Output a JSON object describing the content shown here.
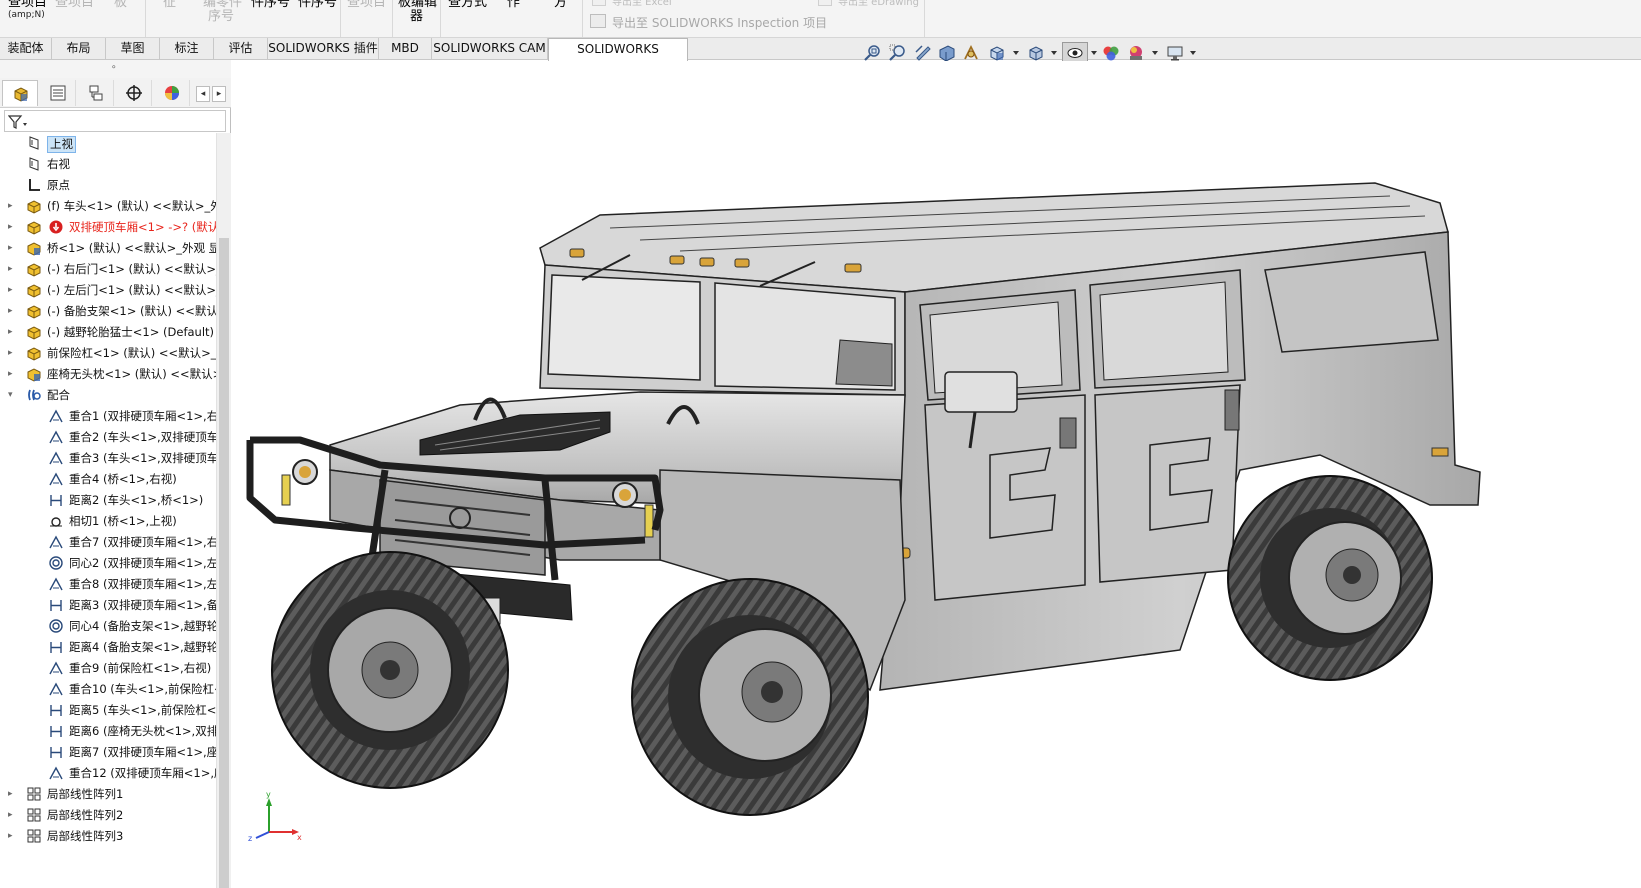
{
  "ribbon": {
    "buttons": [
      {
        "label": "查项目",
        "dim": false
      },
      {
        "label": "查项目",
        "dim": true
      },
      {
        "label": "板",
        "dim": true
      },
      {
        "label": "征",
        "dim": true
      },
      {
        "label": "编零件",
        "dim": true
      },
      {
        "label": "件序号",
        "dim": false
      },
      {
        "label": "件序号",
        "dim": false
      },
      {
        "label": "查项目",
        "dim": true
      },
      {
        "label": "板编辑",
        "dim": false
      },
      {
        "label": "查方式",
        "dim": false
      },
      {
        "label": "作",
        "dim": false
      },
      {
        "label": "方",
        "dim": false
      }
    ],
    "sub_label_1": "序号",
    "sub_label_2": "器",
    "shortcut": "(amp;N)",
    "export_top": "导出至 Excel",
    "export_label": "导出至 SOLIDWORKS Inspection 项目",
    "export_right": "导出至 eDrawing"
  },
  "command_tabs": [
    "装配体",
    "布局",
    "草图",
    "标注",
    "评估",
    "SOLIDWORKS 插件",
    "MBD",
    "SOLIDWORKS CAM",
    "SOLIDWORKS Inspection"
  ],
  "active_tab": "SOLIDWORKS Inspection",
  "hud_icons": [
    "zoom-to-fit-icon",
    "zoom-to-area-icon",
    "previous-view-icon",
    "section-view-icon",
    "dynamic-annotation-icon",
    "view-orientation-icon",
    "display-style-icon",
    "hide-show-items-icon",
    "edit-appearance-icon",
    "apply-scene-icon",
    "view-settings-icon"
  ],
  "feature_tree": {
    "tabs": [
      "featuremanager-tab",
      "propertymanager-tab",
      "configurationmanager-tab",
      "dimxpert-tab",
      "display-manager-tab"
    ],
    "items": [
      {
        "label": "上视",
        "icon": "plane-icon",
        "indent": 1,
        "expand": "",
        "selected": true
      },
      {
        "label": "右视",
        "icon": "plane-icon",
        "indent": 1,
        "expand": ""
      },
      {
        "label": "原点",
        "icon": "origin-icon",
        "indent": 1,
        "expand": ""
      },
      {
        "label": "(f) 车头<1> (默认) <<默认>_外",
        "icon": "part-icon",
        "indent": 1,
        "expand": "▸"
      },
      {
        "label": "双排硬顶车厢<1> ->? (默认",
        "icon": "part-icon",
        "indent": 1,
        "expand": "▸",
        "error": true
      },
      {
        "label": "桥<1> (默认) <<默认>_外观 显",
        "icon": "assembly-icon",
        "indent": 1,
        "expand": "▸"
      },
      {
        "label": "(-) 右后门<1> (默认) <<默认>_",
        "icon": "part-icon",
        "indent": 1,
        "expand": "▸"
      },
      {
        "label": "(-) 左后门<1> (默认) <<默认>_",
        "icon": "part-icon",
        "indent": 1,
        "expand": "▸"
      },
      {
        "label": "(-) 备胎支架<1> (默认) <<默认",
        "icon": "part-icon",
        "indent": 1,
        "expand": "▸"
      },
      {
        "label": "(-) 越野轮胎猛士<1> (Default) <",
        "icon": "part-icon",
        "indent": 1,
        "expand": "▸"
      },
      {
        "label": "前保险杠<1> (默认) <<默认>_外",
        "icon": "part-icon",
        "indent": 1,
        "expand": "▸"
      },
      {
        "label": "座椅无头枕<1> (默认) <<默认>_",
        "icon": "assembly-icon",
        "indent": 1,
        "expand": "▸"
      },
      {
        "label": "配合",
        "icon": "mates-icon",
        "indent": 1,
        "expand": "▾"
      },
      {
        "label": "重合1 (双排硬顶车厢<1>,右",
        "icon": "coincident-icon",
        "indent": 2,
        "expand": ""
      },
      {
        "label": "重合2 (车头<1>,双排硬顶车",
        "icon": "coincident-icon",
        "indent": 2,
        "expand": ""
      },
      {
        "label": "重合3 (车头<1>,双排硬顶车",
        "icon": "coincident-icon",
        "indent": 2,
        "expand": ""
      },
      {
        "label": "重合4 (桥<1>,右视)",
        "icon": "coincident-icon",
        "indent": 2,
        "expand": ""
      },
      {
        "label": "距离2 (车头<1>,桥<1>)",
        "icon": "distance-icon",
        "indent": 2,
        "expand": ""
      },
      {
        "label": "相切1 (桥<1>,上视)",
        "icon": "tangent-icon",
        "indent": 2,
        "expand": ""
      },
      {
        "label": "重合7 (双排硬顶车厢<1>,右",
        "icon": "coincident-icon",
        "indent": 2,
        "expand": ""
      },
      {
        "label": "同心2 (双排硬顶车厢<1>,左",
        "icon": "concentric-icon",
        "indent": 2,
        "expand": ""
      },
      {
        "label": "重合8 (双排硬顶车厢<1>,左",
        "icon": "coincident-icon",
        "indent": 2,
        "expand": ""
      },
      {
        "label": "距离3 (双排硬顶车厢<1>,备",
        "icon": "distance-icon",
        "indent": 2,
        "expand": ""
      },
      {
        "label": "同心4 (备胎支架<1>,越野轮",
        "icon": "concentric-icon",
        "indent": 2,
        "expand": ""
      },
      {
        "label": "距离4 (备胎支架<1>,越野轮",
        "icon": "distance-icon",
        "indent": 2,
        "expand": ""
      },
      {
        "label": "重合9 (前保险杠<1>,右视)",
        "icon": "coincident-icon",
        "indent": 2,
        "expand": ""
      },
      {
        "label": "重合10 (车头<1>,前保险杠<",
        "icon": "coincident-icon",
        "indent": 2,
        "expand": ""
      },
      {
        "label": "距离5 (车头<1>,前保险杠<1",
        "icon": "distance-icon",
        "indent": 2,
        "expand": ""
      },
      {
        "label": "距离6 (座椅无头枕<1>,双排",
        "icon": "distance-icon",
        "indent": 2,
        "expand": ""
      },
      {
        "label": "距离7 (双排硬顶车厢<1>,座",
        "icon": "distance-icon",
        "indent": 2,
        "expand": ""
      },
      {
        "label": "重合12 (双排硬顶车厢<1>,座",
        "icon": "coincident-icon",
        "indent": 2,
        "expand": ""
      },
      {
        "label": "局部线性阵列1",
        "icon": "linear-pattern-icon",
        "indent": 1,
        "expand": "▸"
      },
      {
        "label": "局部线性阵列2",
        "icon": "linear-pattern-icon",
        "indent": 1,
        "expand": "▸"
      },
      {
        "label": "局部线性阵列3",
        "icon": "linear-pattern-icon",
        "indent": 1,
        "expand": "▸"
      }
    ]
  },
  "viewport": {
    "model": "military-suv-3d-model",
    "triad_axes": [
      "y",
      "z",
      "x"
    ],
    "colors": {
      "body": "#c9c9c9",
      "dark": "#2a2a2a",
      "amber": "#d9a43a",
      "axis_x": "#e03030",
      "axis_y": "#2ba02b",
      "axis_z": "#3050d8"
    }
  }
}
